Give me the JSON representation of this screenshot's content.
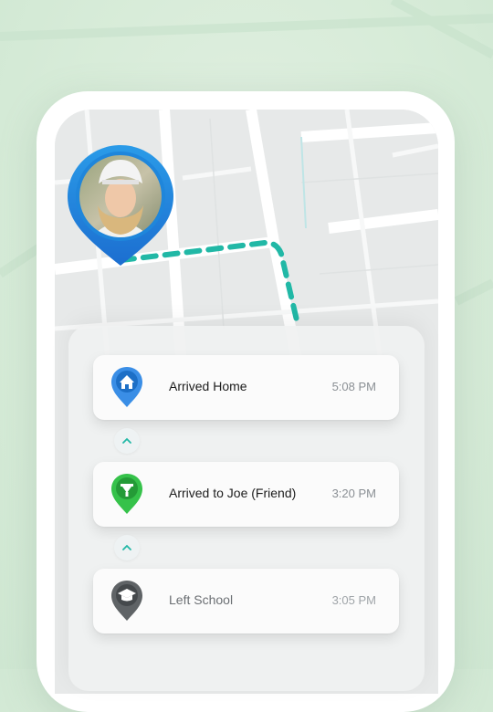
{
  "accent_color": "#21b8a6",
  "timeline": [
    {
      "title": "Arrived Home",
      "time": "5:08 PM",
      "icon": "home-pin-icon",
      "pin_color": "#3a8ee6"
    },
    {
      "title": "Arrived to Joe (Friend)",
      "time": "3:20 PM",
      "icon": "friend-pin-icon",
      "pin_color": "#35c24a"
    },
    {
      "title": "Left School",
      "time": "3:05 PM",
      "icon": "school-pin-icon",
      "pin_color": "#5f6366"
    }
  ],
  "icons": {
    "expand_1": "chevron-up-icon",
    "expand_2": "chevron-up-icon",
    "avatar": "child-avatar-pin"
  }
}
